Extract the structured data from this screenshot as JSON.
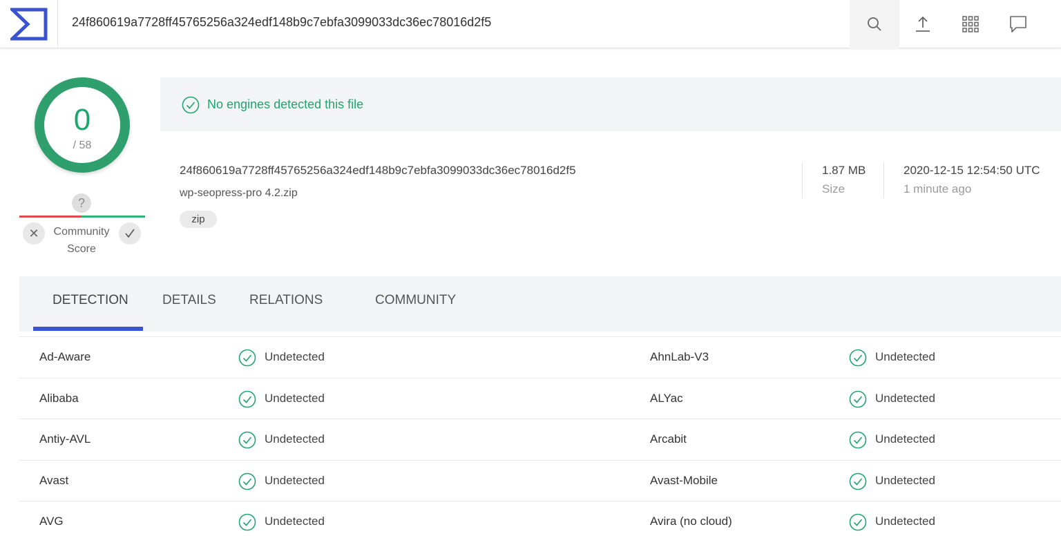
{
  "search": {
    "query": "24f860619a7728ff45765256a324edf148b9c7ebfa3099033dc36ec78016d2f5"
  },
  "icons": {
    "logo": "virustotal-logo",
    "search": "search-icon",
    "upload": "upload-icon",
    "apps": "apps-grid-icon",
    "chat": "chat-icon"
  },
  "score": {
    "detections": "0",
    "total": "/ 58"
  },
  "community": {
    "question": "?",
    "label_line1": "Community",
    "label_line2": "Score",
    "dislike": "✕"
  },
  "banner": {
    "text": "No engines detected this file"
  },
  "file": {
    "hash": "24f860619a7728ff45765256a324edf148b9c7ebfa3099033dc36ec78016d2f5",
    "name": "wp-seopress-pro 4.2.zip",
    "tag": "zip",
    "size": "1.87 MB",
    "size_label": "Size",
    "date": "2020-12-15 12:54:50 UTC",
    "date_relative": "1 minute ago"
  },
  "tabs": [
    {
      "label": "DETECTION"
    },
    {
      "label": "DETAILS"
    },
    {
      "label": "RELATIONS"
    },
    {
      "label": "COMMUNITY"
    }
  ],
  "results": [
    {
      "left": {
        "engine": "Ad-Aware",
        "status": "Undetected"
      },
      "right": {
        "engine": "AhnLab-V3",
        "status": "Undetected"
      }
    },
    {
      "left": {
        "engine": "Alibaba",
        "status": "Undetected"
      },
      "right": {
        "engine": "ALYac",
        "status": "Undetected"
      }
    },
    {
      "left": {
        "engine": "Antiy-AVL",
        "status": "Undetected"
      },
      "right": {
        "engine": "Arcabit",
        "status": "Undetected"
      }
    },
    {
      "left": {
        "engine": "Avast",
        "status": "Undetected"
      },
      "right": {
        "engine": "Avast-Mobile",
        "status": "Undetected"
      }
    },
    {
      "left": {
        "engine": "AVG",
        "status": "Undetected"
      },
      "right": {
        "engine": "Avira (no cloud)",
        "status": "Undetected"
      }
    }
  ],
  "colors": {
    "accent": "#3a53d0",
    "clean": "#1fa570",
    "malicious": "#e04a4a"
  }
}
